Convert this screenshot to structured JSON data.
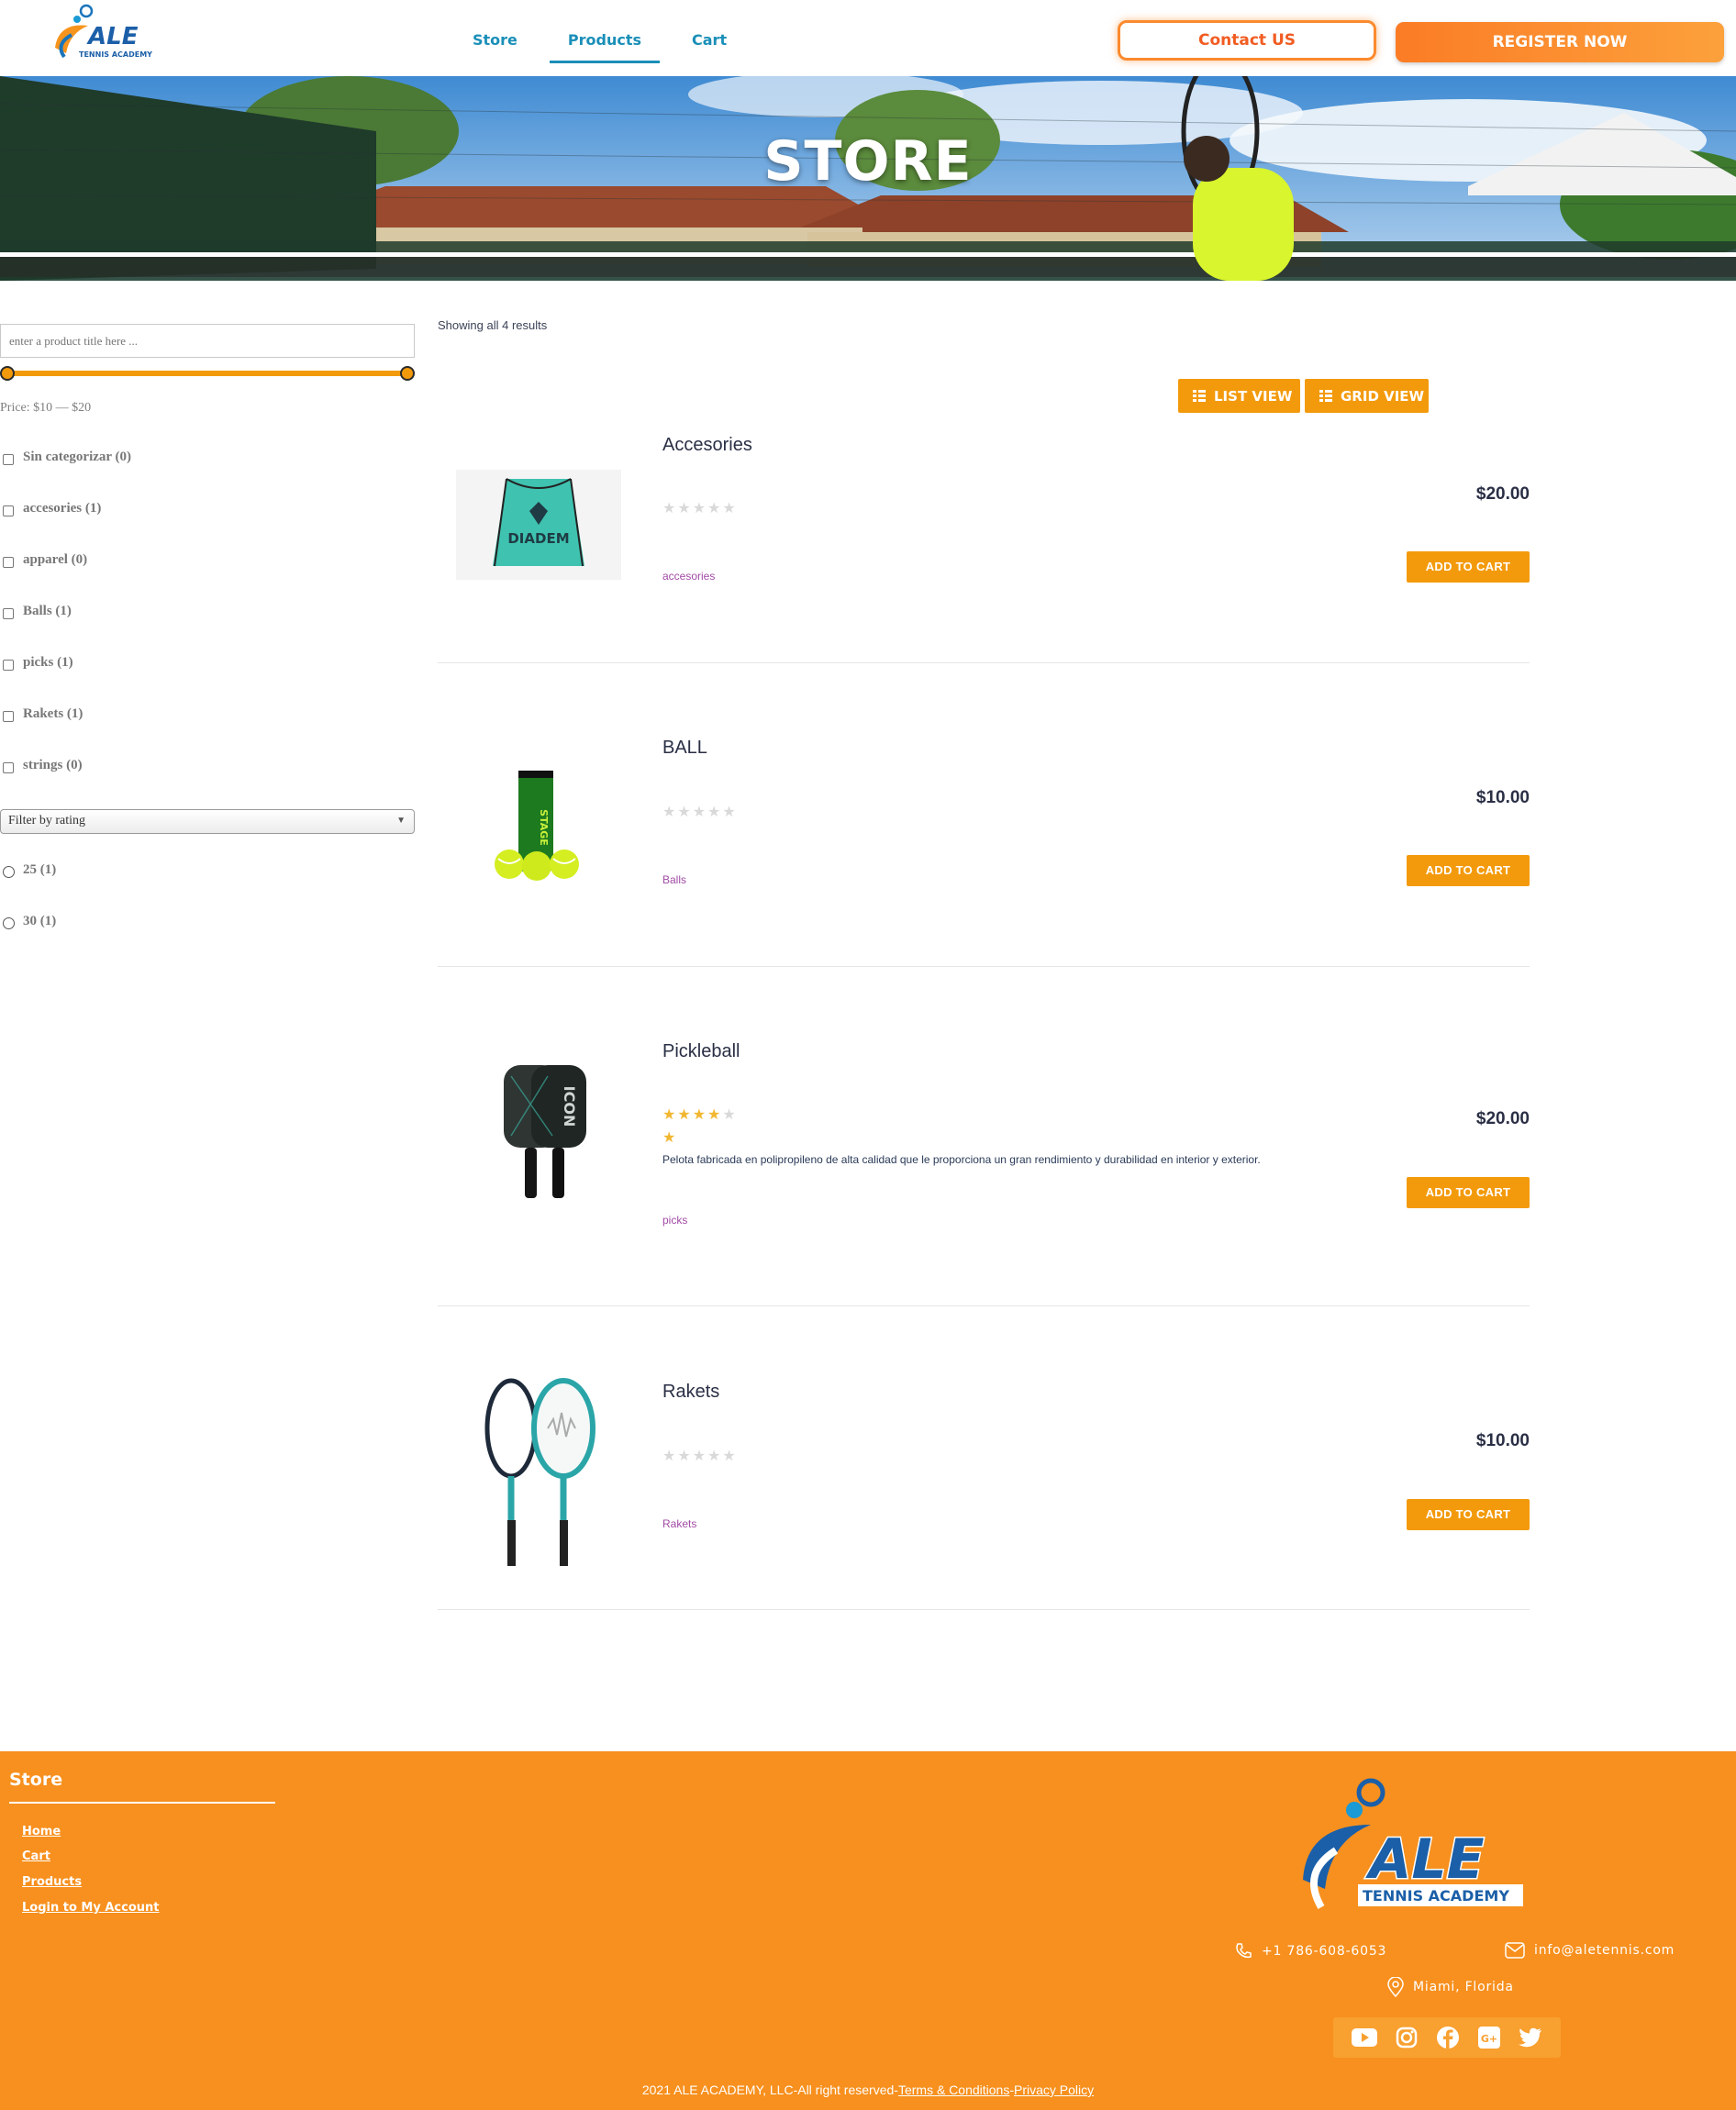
{
  "header": {
    "logo_text": "ALE",
    "logo_sub": "TENNIS ACADEMY",
    "nav": [
      {
        "label": "Store"
      },
      {
        "label": "Products"
      },
      {
        "label": "Cart"
      }
    ],
    "contact_label": "Contact US",
    "register_label": "REGISTER NOW"
  },
  "hero": {
    "title": "STORE"
  },
  "sidebar": {
    "search_placeholder": "enter a product title here ...",
    "price_label": "Price: $10 — $20",
    "categories": [
      {
        "label": "Sin categorizar (0)"
      },
      {
        "label": "accesories (1)"
      },
      {
        "label": "apparel (0)"
      },
      {
        "label": "Balls (1)"
      },
      {
        "label": "picks (1)"
      },
      {
        "label": "Rakets (1)"
      },
      {
        "label": "strings (0)"
      }
    ],
    "rating_filter_label": "Filter by rating",
    "ratings": [
      {
        "label": "25 (1)"
      },
      {
        "label": "30 (1)"
      }
    ]
  },
  "main": {
    "results_text": "Showing all 4 results",
    "list_view_label": "LIST VIEW",
    "grid_view_label": "GRID VIEW",
    "stars_icon": "★★★★★",
    "products": [
      {
        "name": "Accesories",
        "price": "$20.00",
        "category": "accesories",
        "rating": 0,
        "description": "",
        "cart_label": "ADD TO CART",
        "image": "drawstring-bag-image",
        "image_text": "DIADEM"
      },
      {
        "name": "BALL",
        "price": "$10.00",
        "category": "Balls",
        "rating": 0,
        "description": "",
        "cart_label": "ADD TO CART",
        "image": "tennis-balls-can-image",
        "image_text": "STAGE"
      },
      {
        "name": "Pickleball",
        "price": "$20.00",
        "category": "picks",
        "rating": 4,
        "description": "Pelota fabricada en polipropileno de alta calidad que le proporciona un gran rendimiento y durabilidad en interior y exterior.",
        "cart_label": "ADD TO CART",
        "image": "pickleball-paddles-image",
        "image_text": "ICON"
      },
      {
        "name": "Rakets",
        "price": "$10.00",
        "category": "Rakets",
        "rating": 0,
        "description": "",
        "cart_label": "ADD TO CART",
        "image": "tennis-rackets-image",
        "image_text": ""
      }
    ]
  },
  "footer": {
    "title": "Store",
    "links": [
      {
        "label": "Home"
      },
      {
        "label": "Cart"
      },
      {
        "label": "Products"
      },
      {
        "label": "Login to My Account"
      }
    ],
    "logo_text": "ALE",
    "logo_sub": "TENNIS ACADEMY",
    "phone": "+1 786-608-6053",
    "email": "info@aletennis.com",
    "location": "Miami, Florida",
    "social_icons": [
      "youtube-icon",
      "instagram-icon",
      "facebook-icon",
      "google-plus-icon",
      "twitter-icon"
    ],
    "copyright_prefix": "2021 ALE ACADEMY, LLC-All right reserved-",
    "terms_label": "Terms & Conditions",
    "separator": "-",
    "privacy_label": "Privacy Policy"
  },
  "colors": {
    "accent_orange": "#f39a0c",
    "footer_orange": "#f7901e",
    "nav_blue": "#1a8fb8",
    "contact_red": "#f15c22",
    "category_purple": "#a24ba6",
    "star_gold": "#f2b731"
  }
}
